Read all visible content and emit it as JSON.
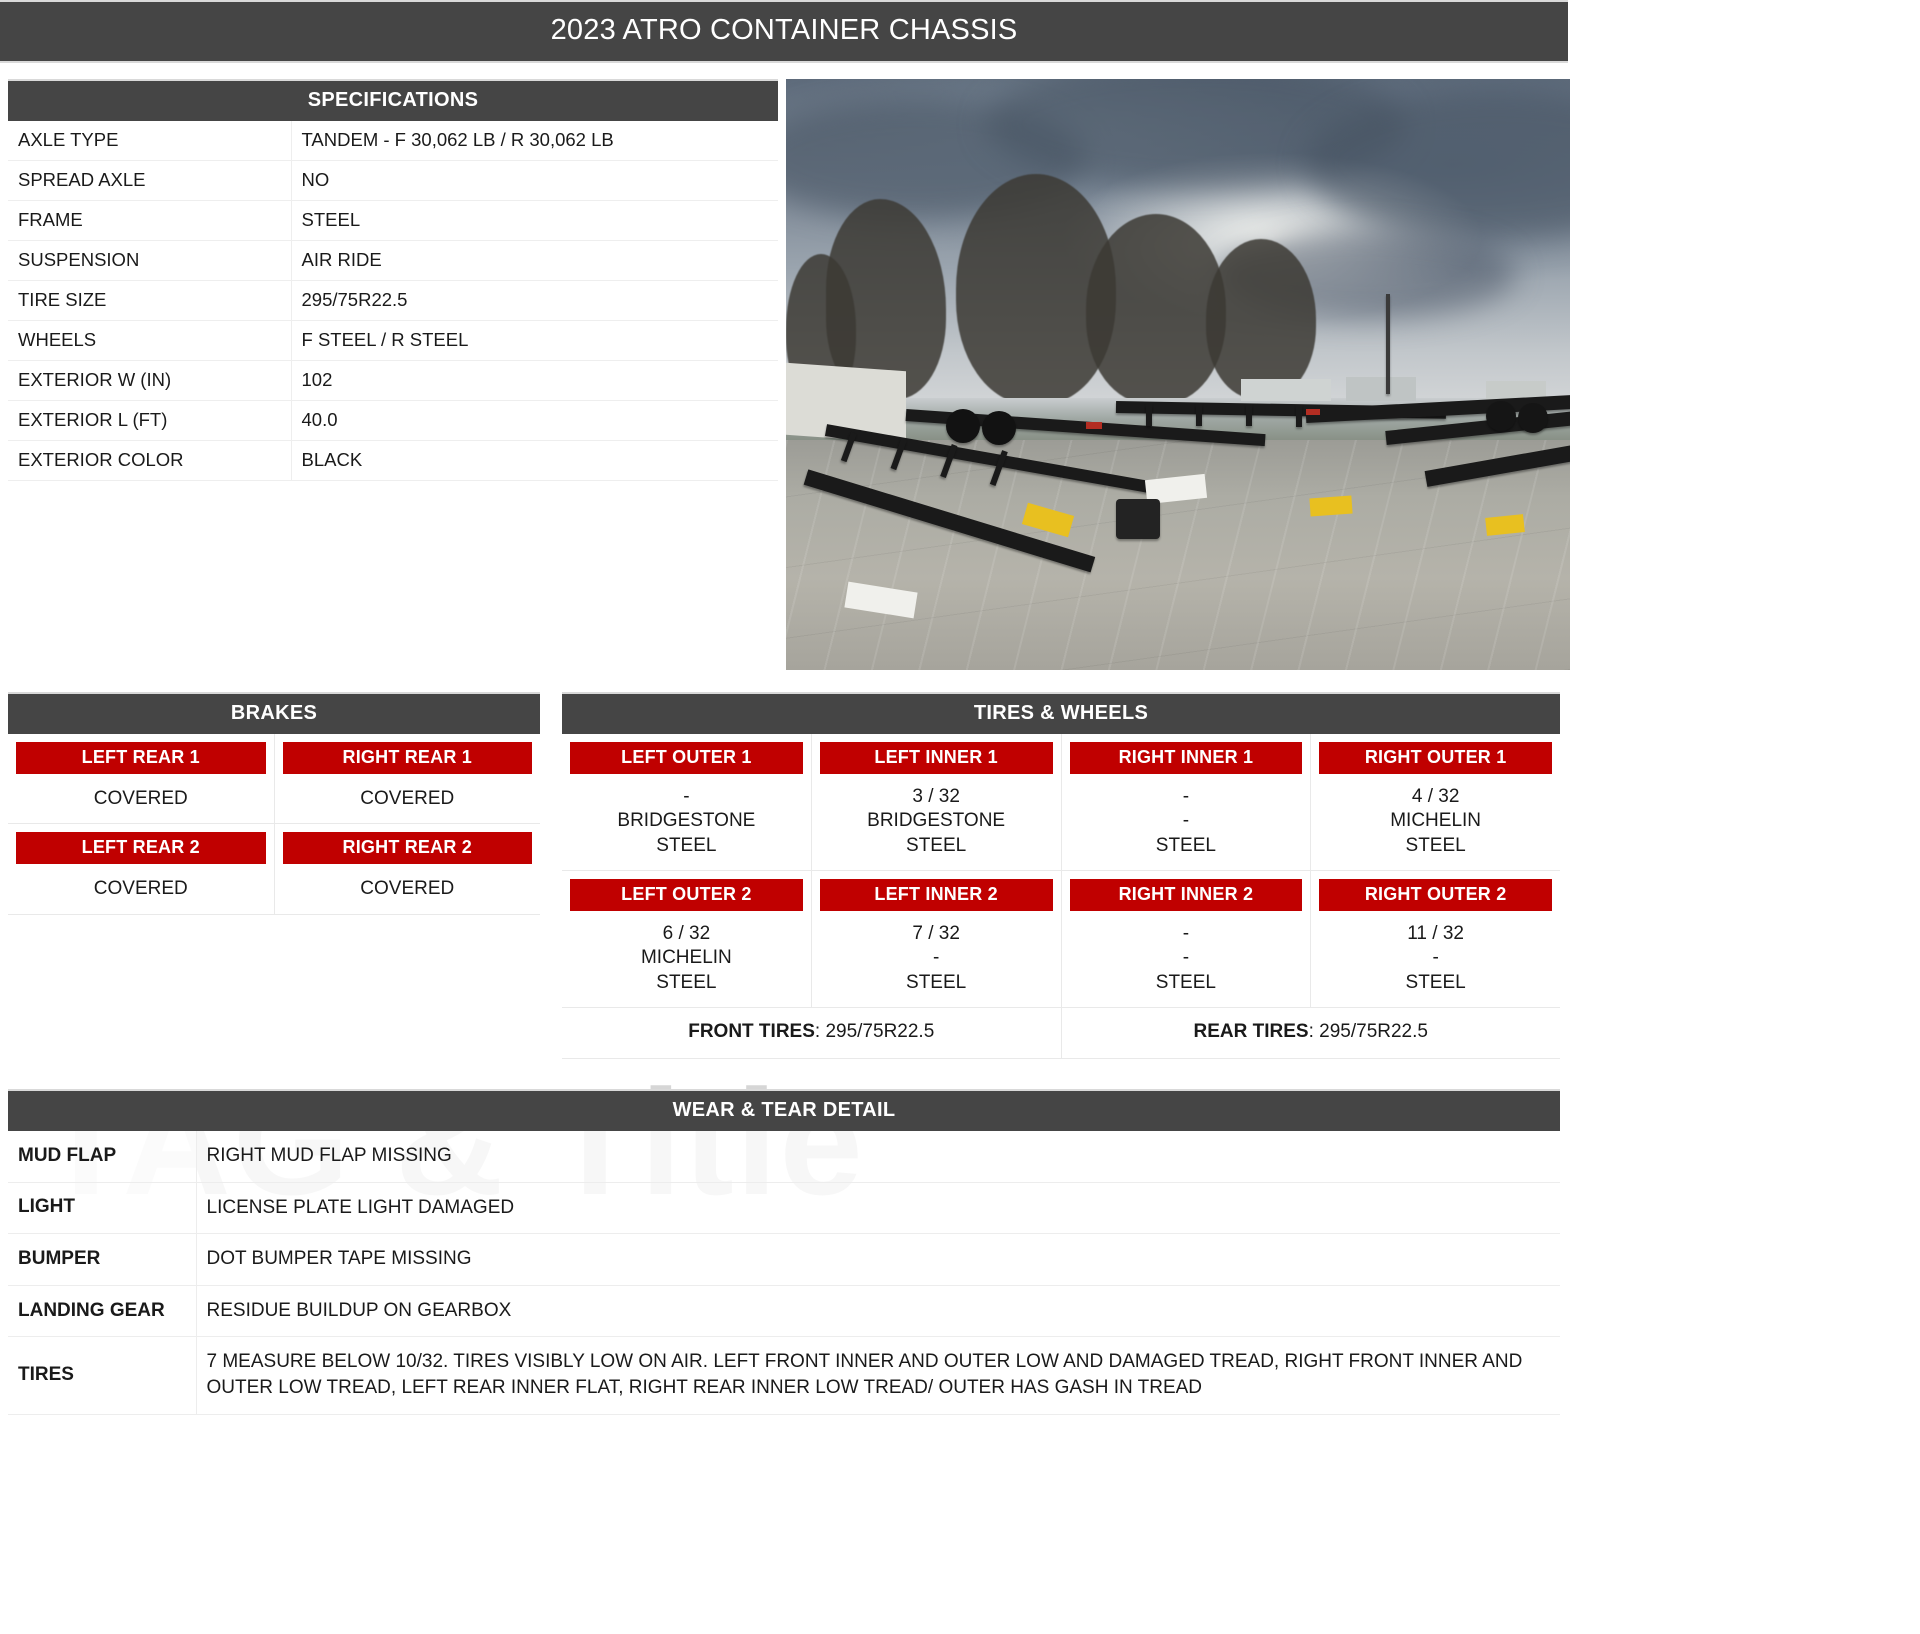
{
  "header": {
    "title": "2023 ATRO CONTAINER CHASSIS"
  },
  "colors": {
    "header_bg": "#454545",
    "badge_red": "#c00000",
    "text": "#1a1a1a"
  },
  "specifications": {
    "heading": "SPECIFICATIONS",
    "rows": [
      {
        "label": "AXLE TYPE",
        "value": "TANDEM - F 30,062 LB / R 30,062 LB"
      },
      {
        "label": "SPREAD AXLE",
        "value": "NO"
      },
      {
        "label": "FRAME",
        "value": "STEEL"
      },
      {
        "label": "SUSPENSION",
        "value": "AIR RIDE"
      },
      {
        "label": "TIRE SIZE",
        "value": "295/75R22.5"
      },
      {
        "label": "WHEELS",
        "value": "F STEEL / R STEEL"
      },
      {
        "label": "EXTERIOR W (IN)",
        "value": "102"
      },
      {
        "label": "EXTERIOR L (FT)",
        "value": "40.0"
      },
      {
        "label": "EXTERIOR COLOR",
        "value": "BLACK"
      }
    ]
  },
  "photo": {
    "alt": "container chassis yard photo"
  },
  "brakes": {
    "heading": "BRAKES",
    "cells": [
      {
        "label": "LEFT REAR 1",
        "value": "COVERED"
      },
      {
        "label": "RIGHT REAR 1",
        "value": "COVERED"
      },
      {
        "label": "LEFT REAR 2",
        "value": "COVERED"
      },
      {
        "label": "RIGHT REAR 2",
        "value": "COVERED"
      }
    ]
  },
  "tires_wheels": {
    "heading": "TIRES & WHEELS",
    "cells": [
      {
        "label": "LEFT OUTER 1",
        "tread": "-",
        "brand": "BRIDGESTONE",
        "wheel": "STEEL"
      },
      {
        "label": "LEFT INNER 1",
        "tread": "3 / 32",
        "brand": "BRIDGESTONE",
        "wheel": "STEEL"
      },
      {
        "label": "RIGHT INNER 1",
        "tread": "-",
        "brand": "-",
        "wheel": "STEEL"
      },
      {
        "label": "RIGHT OUTER 1",
        "tread": "4 / 32",
        "brand": "MICHELIN",
        "wheel": "STEEL"
      },
      {
        "label": "LEFT OUTER 2",
        "tread": "6 / 32",
        "brand": "MICHELIN",
        "wheel": "STEEL"
      },
      {
        "label": "LEFT INNER 2",
        "tread": "7 / 32",
        "brand": "-",
        "wheel": "STEEL"
      },
      {
        "label": "RIGHT INNER 2",
        "tread": "-",
        "brand": "-",
        "wheel": "STEEL"
      },
      {
        "label": "RIGHT OUTER 2",
        "tread": "11 / 32",
        "brand": "-",
        "wheel": "STEEL"
      }
    ],
    "footer": {
      "front_label": "FRONT TIRES",
      "front_value": "295/75R22.5",
      "rear_label": "REAR TIRES",
      "rear_value": "295/75R22.5"
    }
  },
  "wear_tear": {
    "heading": "WEAR & TEAR DETAIL",
    "watermark": "TAG & Title",
    "rows": [
      {
        "label": "MUD FLAP",
        "value": "RIGHT MUD FLAP MISSING"
      },
      {
        "label": "LIGHT",
        "value": "LICENSE PLATE LIGHT DAMAGED"
      },
      {
        "label": "BUMPER",
        "value": "DOT BUMPER TAPE MISSING"
      },
      {
        "label": "LANDING GEAR",
        "value": "RESIDUE BUILDUP ON GEARBOX"
      },
      {
        "label": "TIRES",
        "value": "7 MEASURE BELOW 10/32. TIRES VISIBLY LOW ON AIR. LEFT FRONT INNER AND OUTER LOW AND DAMAGED TREAD, RIGHT FRONT INNER AND OUTER LOW TREAD, LEFT REAR INNER FLAT, RIGHT REAR INNER LOW TREAD/ OUTER HAS GASH IN TREAD"
      }
    ]
  }
}
